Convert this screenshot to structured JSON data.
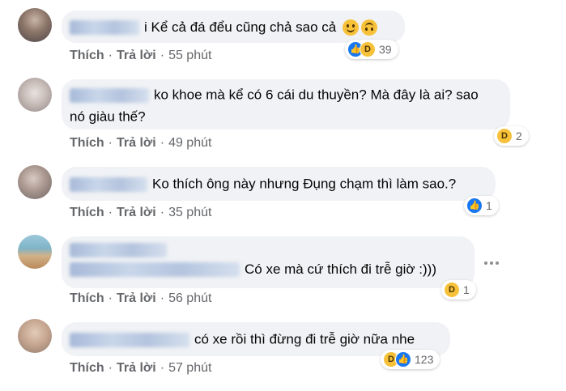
{
  "comments": [
    {
      "text": "i Kể cả đá đểu cũng chả sao cả",
      "reaction_count": "39",
      "actions": {
        "like": "Thích",
        "reply": "Trả lời",
        "time": "55 phút"
      }
    },
    {
      "text_line1": "ko khoe mà kể có 6 cái du thuyền? Mà đây là ai? sao",
      "text_line2": "nó giàu thế?",
      "reaction_count": "2",
      "actions": {
        "like": "Thích",
        "reply": "Trả lời",
        "time": "49 phút"
      }
    },
    {
      "text": "Ko thích ông này nhưng Đụng chạm thì làm sao.?",
      "reaction_count": "1",
      "actions": {
        "like": "Thích",
        "reply": "Trả lời",
        "time": "35 phút"
      }
    },
    {
      "text": "Có xe mà cứ thích đi trễ giờ :)))",
      "reaction_count": "1",
      "actions": {
        "like": "Thích",
        "reply": "Trả lời",
        "time": "56 phút"
      }
    },
    {
      "text": "có xe rồi thì đừng đi trễ giờ nữa nhe",
      "reaction_count": "123",
      "actions": {
        "like": "Thích",
        "reply": "Trả lời",
        "time": "57 phút"
      }
    }
  ],
  "separator": "·",
  "icons": {
    "like": "like-icon",
    "haha": "haha-icon",
    "smile": "smile-emoji-icon",
    "upside_down": "upside-down-emoji-icon",
    "more": "more-options-icon"
  },
  "colors": {
    "bubble": "#f0f2f5",
    "meta_text": "#65676b",
    "like_blue": "#1877f2",
    "haha_yellow": "#f7c23a"
  }
}
